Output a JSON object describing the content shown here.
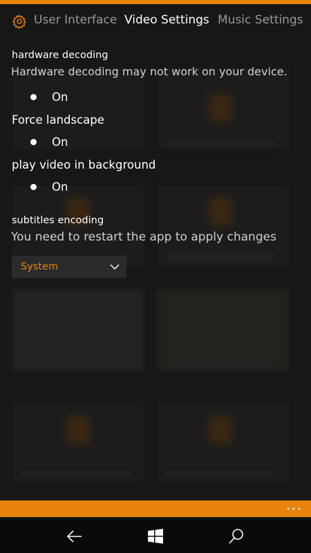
{
  "header": {
    "tabs": [
      {
        "label": "User Interface",
        "active": false
      },
      {
        "label": "Video Settings",
        "active": true
      },
      {
        "label": "Music Settings",
        "active": false
      }
    ]
  },
  "settings": {
    "hardware_decoding": {
      "label": "hardware decoding",
      "description": "Hardware decoding may not work on your device.",
      "option_label": "On"
    },
    "force_landscape": {
      "label": "Force landscape",
      "option_label": "On"
    },
    "play_in_background": {
      "label": "play video in background",
      "option_label": "On"
    },
    "subtitles_encoding": {
      "label": "subtitles encoding",
      "description": "You need to restart the app to apply changes",
      "selected": "System"
    }
  },
  "colors": {
    "accent": "#e8830c",
    "background": "#1b1b1b",
    "nav_bar": "#0a0a0a"
  },
  "icons": {
    "settings": "gear-icon",
    "combo": "chevron-down-icon",
    "app_bar": "more-icon",
    "nav_back": "back-icon",
    "nav_start": "windows-icon",
    "nav_search": "search-icon"
  }
}
